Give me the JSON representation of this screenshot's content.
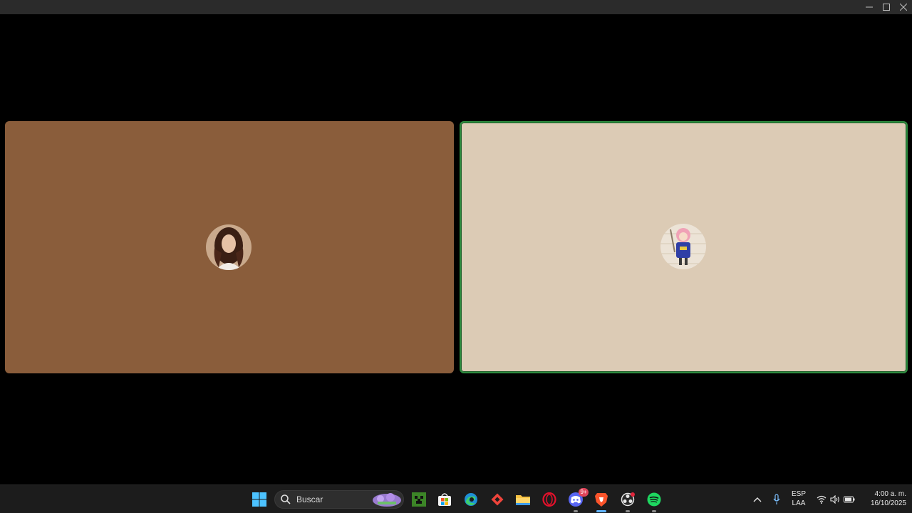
{
  "window": {
    "controls": {
      "minimize_icon": "minimize-icon",
      "maximize_icon": "maximize-icon",
      "close_icon": "close-icon"
    }
  },
  "participants": [
    {
      "tile_color": "#8a5d3b",
      "speaking": false,
      "avatar_icon": "woman-portrait-avatar"
    },
    {
      "tile_color": "#dccbb5",
      "speaking": true,
      "speaking_border_color": "#2d8a3e",
      "avatar_icon": "anime-girl-avatar"
    }
  ],
  "taskbar": {
    "search": {
      "placeholder": "Buscar"
    },
    "apps": [
      {
        "name": "start",
        "icon": "windows-logo-icon"
      },
      {
        "name": "minecraft",
        "icon": "minecraft-icon"
      },
      {
        "name": "microsoft-store",
        "icon": "store-icon"
      },
      {
        "name": "edge",
        "icon": "edge-icon"
      },
      {
        "name": "anydesk",
        "icon": "anydesk-icon"
      },
      {
        "name": "file-explorer",
        "icon": "folder-icon"
      },
      {
        "name": "opera",
        "icon": "opera-icon"
      },
      {
        "name": "discord",
        "icon": "discord-icon",
        "badge": "9+"
      },
      {
        "name": "brave",
        "icon": "brave-icon",
        "active": true
      },
      {
        "name": "obs",
        "icon": "obs-icon"
      },
      {
        "name": "spotify",
        "icon": "spotify-icon"
      }
    ],
    "tray": {
      "language_line1": "ESP",
      "language_line2": "LAA",
      "time": "4:00 a. m.",
      "date": "16/10/2025"
    }
  },
  "colors": {
    "accent_speaking": "#2d8a3e",
    "taskbar_bg": "#1c1c1c",
    "active_indicator": "#60b4ff"
  }
}
